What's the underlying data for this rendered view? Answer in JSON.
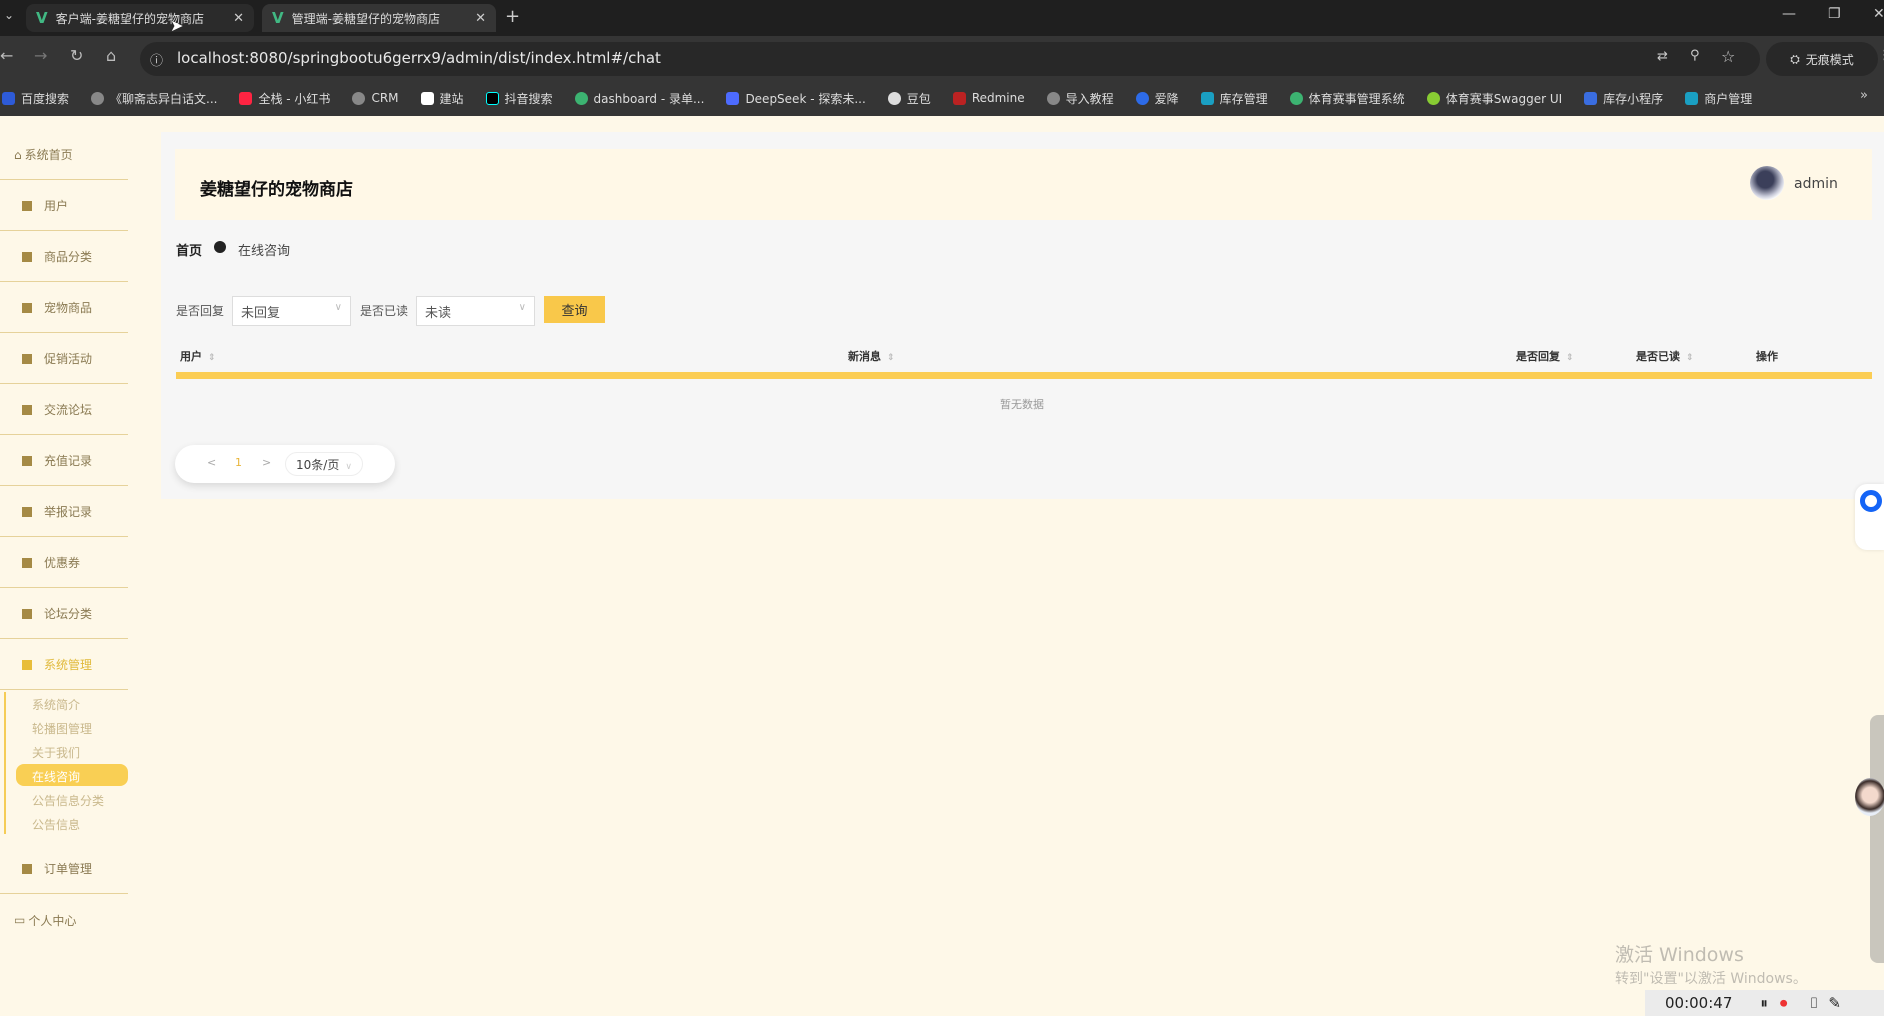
{
  "browser": {
    "tabs": [
      {
        "label": "客户端-姜糖望仔的宠物商店",
        "active": false
      },
      {
        "label": "管理端-姜糖望仔的宠物商店",
        "active": true
      }
    ],
    "url": "localhost:8080/springbootu6gerrx9/admin/dist/index.html#/chat",
    "incognito_label": "无痕模式",
    "bookmarks": [
      "百度搜索",
      "《聊斋志异白话文...",
      "全栈 - 小红书",
      "CRM",
      "建站",
      "抖音搜索",
      "dashboard - 录单...",
      "DeepSeek - 探索未...",
      "豆包",
      "Redmine",
      "导入教程",
      "爱降",
      "库存管理",
      "体育赛事管理系统",
      "体育赛事Swagger UI",
      "库存小程序",
      "商户管理"
    ]
  },
  "sidebar": {
    "items": [
      {
        "label": "系统首页",
        "icon": "home-icon"
      },
      {
        "label": "用户",
        "icon": "briefcase-icon"
      },
      {
        "label": "商品分类",
        "icon": "grid-icon"
      },
      {
        "label": "宠物商品",
        "icon": "grid-icon"
      },
      {
        "label": "促销活动",
        "icon": "grid-icon"
      },
      {
        "label": "交流论坛",
        "icon": "pin-icon"
      },
      {
        "label": "充值记录",
        "icon": "grid-icon"
      },
      {
        "label": "举报记录",
        "icon": "grid-icon"
      },
      {
        "label": "优惠券",
        "icon": "clipboard-icon"
      },
      {
        "label": "论坛分类",
        "icon": "grid-icon"
      },
      {
        "label": "系统管理",
        "icon": "checklist-icon"
      }
    ],
    "subitems": [
      "系统简介",
      "轮播图管理",
      "关于我们",
      "在线咨询",
      "公告信息分类",
      "公告信息"
    ],
    "active_subitem": "在线咨询",
    "tail_items": [
      {
        "label": "订单管理",
        "icon": "list-icon"
      },
      {
        "label": "个人中心",
        "icon": "wallet-icon"
      }
    ]
  },
  "header": {
    "title": "姜糖望仔的宠物商店",
    "username": "admin"
  },
  "breadcrumb": {
    "home": "首页",
    "current": "在线咨询"
  },
  "filters": {
    "reply_label": "是否回复",
    "reply_value": "未回复",
    "read_label": "是否已读",
    "read_value": "未读",
    "query_button": "查询"
  },
  "table": {
    "columns": [
      "用户",
      "新消息",
      "是否回复",
      "是否已读",
      "操作"
    ],
    "empty_text": "暂无数据"
  },
  "pagination": {
    "prev": "<",
    "page": "1",
    "next": ">",
    "page_size": "10条/页"
  },
  "accent_color": "#f9cf54",
  "overlay": {
    "watermark_title": "激活 Windows",
    "watermark_sub": "转到\"设置\"以激活 Windows。",
    "recording_time": "00:00:47"
  }
}
